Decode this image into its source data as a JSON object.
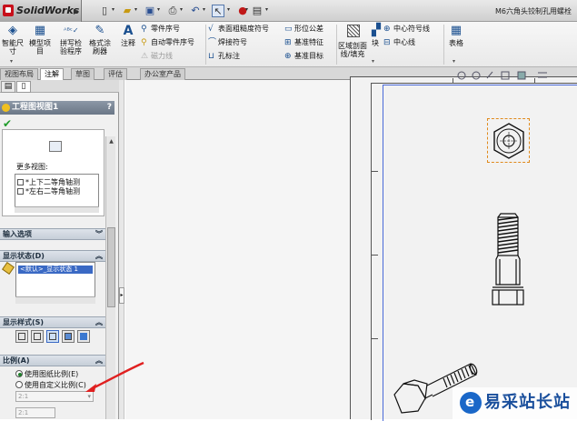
{
  "app": {
    "name": "SolidWorks",
    "document_title": "M6六角头铰制孔用螺栓"
  },
  "ribbon": {
    "smart_dim": "智能尺寸",
    "model_items": "模型项目",
    "spell_check": "拼写检验程序",
    "format_painter": "格式涂刷器",
    "note": "注释",
    "balloon": "零件序号",
    "auto_balloon": "自动零件序号",
    "magnetic_line": "磁力线",
    "surface_finish": "表面粗糙度符号",
    "weld_symbol": "焊接符号",
    "hole_callout": "孔标注",
    "gtol": "形位公差",
    "datum_feature": "基准特征",
    "datum_target": "基准目标",
    "area_hatch": "区域剖面线/填充",
    "block": "块",
    "center_mark": "中心符号线",
    "centerline": "中心线",
    "table": "表格"
  },
  "tabs": [
    "视图布局",
    "注解",
    "草图",
    "评估",
    "办公室产品"
  ],
  "active_tab": "注解",
  "panel": {
    "title": "工程图视图1",
    "help": "?",
    "more_views_label": "更多视图:",
    "more_views": [
      "*上下二等角轴测",
      "*左右二等角轴测"
    ],
    "section_input": "输入选项",
    "section_display_state": "显示状态(D)",
    "display_state_item": "<默认>_显示状态 1",
    "section_display_style": "显示样式(S)",
    "section_scale": "比例(A)",
    "radio_sheet_scale": "使用图纸比例(E)",
    "radio_custom_scale": "使用自定义比例(C)",
    "scale_select_value": "2:1",
    "scale_input_value": "2:1"
  },
  "watermark": {
    "text": "易采站长站"
  }
}
